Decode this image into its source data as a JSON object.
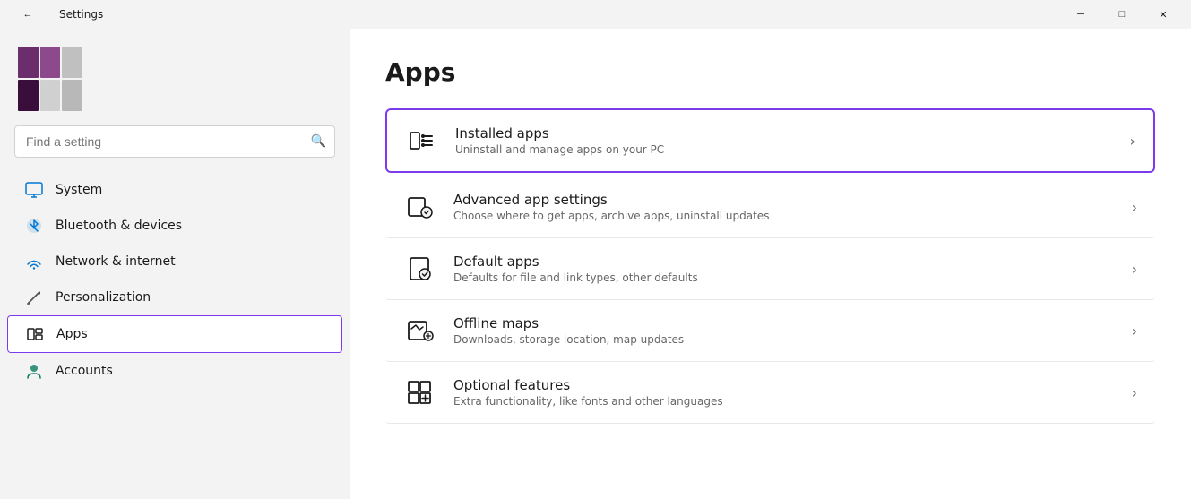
{
  "titlebar": {
    "title": "Settings",
    "back_label": "←",
    "minimize_label": "─",
    "maximize_label": "□",
    "close_label": "✕"
  },
  "sidebar": {
    "search_placeholder": "Find a setting",
    "nav_items": [
      {
        "id": "system",
        "label": "System",
        "icon": "🖥"
      },
      {
        "id": "bluetooth",
        "label": "Bluetooth & devices",
        "icon": "🔵"
      },
      {
        "id": "network",
        "label": "Network & internet",
        "icon": "📶"
      },
      {
        "id": "personalization",
        "label": "Personalization",
        "icon": "✏"
      },
      {
        "id": "apps",
        "label": "Apps",
        "icon": "📦",
        "active": true
      },
      {
        "id": "accounts",
        "label": "Accounts",
        "icon": "👤"
      }
    ]
  },
  "content": {
    "page_title": "Apps",
    "settings_items": [
      {
        "id": "installed-apps",
        "title": "Installed apps",
        "description": "Uninstall and manage apps on your PC",
        "highlighted": true
      },
      {
        "id": "advanced-app-settings",
        "title": "Advanced app settings",
        "description": "Choose where to get apps, archive apps, uninstall updates",
        "highlighted": false
      },
      {
        "id": "default-apps",
        "title": "Default apps",
        "description": "Defaults for file and link types, other defaults",
        "highlighted": false
      },
      {
        "id": "offline-maps",
        "title": "Offline maps",
        "description": "Downloads, storage location, map updates",
        "highlighted": false
      },
      {
        "id": "optional-features",
        "title": "Optional features",
        "description": "Extra functionality, like fonts and other languages",
        "highlighted": false
      }
    ]
  },
  "icons": {
    "installed_apps": "≡≣",
    "advanced_app_settings": "⚙",
    "default_apps": "✓",
    "offline_maps": "🗺",
    "optional_features": "⊞",
    "chevron": "›"
  }
}
